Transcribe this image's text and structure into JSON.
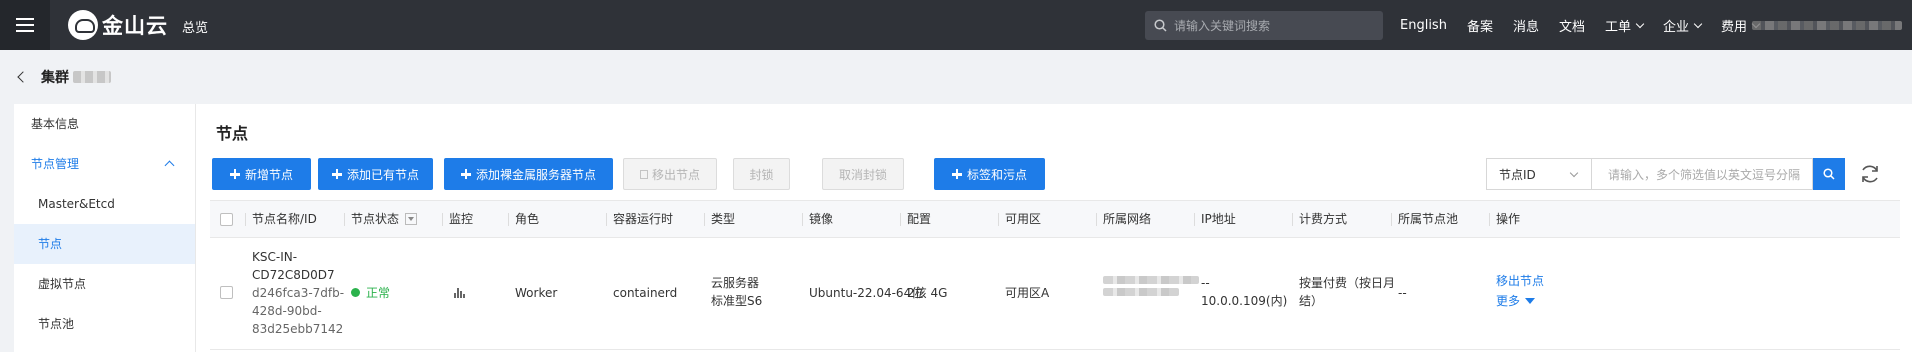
{
  "topbar": {
    "logo_text": "金山云",
    "overview": "总览",
    "search_placeholder": "请输入关键词搜索",
    "nav": [
      "English",
      "备案",
      "消息",
      "文档"
    ],
    "nav_dropdowns": [
      "工单",
      "企业",
      "费用"
    ]
  },
  "breadcrumb": {
    "title": "集群"
  },
  "sidebar": {
    "items": [
      {
        "label": "基本信息"
      },
      {
        "label": "节点管理"
      },
      {
        "label": "Master&Etcd"
      },
      {
        "label": "节点"
      },
      {
        "label": "虚拟节点"
      },
      {
        "label": "节点池"
      }
    ]
  },
  "main": {
    "title": "节点",
    "buttons": {
      "add_node": "新增节点",
      "add_existing": "添加已有节点",
      "add_bare_metal": "添加裸金属服务器节点",
      "remove_node": "移出节点",
      "cordon": "封锁",
      "uncordon": "取消封锁",
      "labels_taints": "标签和污点"
    },
    "filter": {
      "field": "节点ID",
      "placeholder": "请输入，多个筛选值以英文逗号分隔"
    }
  },
  "table": {
    "headers": [
      "节点名称/ID",
      "节点状态",
      "监控",
      "角色",
      "容器运行时",
      "类型",
      "镜像",
      "配置",
      "可用区",
      "所属网络",
      "IP地址",
      "计费方式",
      "所属节点池",
      "操作"
    ],
    "rows": [
      {
        "name_lines": [
          "KSC-IN-",
          "CD72C8D0D7"
        ],
        "id_lines": [
          "d246fca3-7dfb-",
          "428d-90bd-",
          "83d25ebb7142"
        ],
        "status": "正常",
        "role": "Worker",
        "runtime": "containerd",
        "type_lines": [
          "云服务器",
          "标准型S6"
        ],
        "image": "Ubuntu-22.04-64位",
        "config": "2核 4G",
        "zone": "可用区A",
        "ip_lines": [
          "--",
          "10.0.0.109(内)"
        ],
        "billing_lines": [
          "按量付费（按日月",
          "结）"
        ],
        "node_pool": "--",
        "actions": {
          "remove": "移出节点",
          "more": "更多"
        }
      }
    ]
  },
  "colors": {
    "primary": "#1e7ce8",
    "topbar": "#2f3238",
    "status_ok": "#2bb24c"
  }
}
